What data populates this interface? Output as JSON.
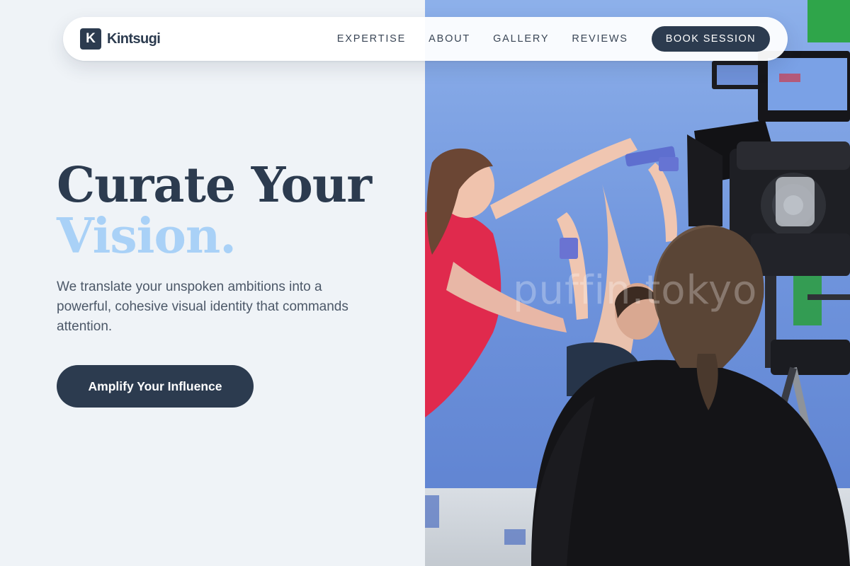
{
  "brand": {
    "mark_letter": "K",
    "name": "Kintsugi"
  },
  "nav": {
    "links": [
      {
        "label": "EXPERTISE"
      },
      {
        "label": "ABOUT"
      },
      {
        "label": "GALLERY"
      },
      {
        "label": "REVIEWS"
      }
    ],
    "cta_label": "BOOK SESSION"
  },
  "hero": {
    "headline_line1": "Curate Your",
    "headline_line2": "Vision.",
    "subcopy": "We translate your unspoken ambitions into a powerful, cohesive visual identity that commands attention.",
    "cta_label": "Amplify Your Influence",
    "photo_watermark": "puffin.tokyo"
  },
  "colors": {
    "primary_dark": "#2c3b4f",
    "accent_light_blue": "#a9d1f7",
    "page_background": "#eff3f7",
    "backdrop_blue": "#6f95dc"
  },
  "icons": {
    "brand_mark": "k-logo-icon"
  }
}
